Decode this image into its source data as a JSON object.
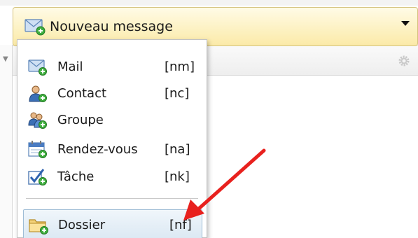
{
  "toolbar": {
    "new_button_label": "Nouveau message",
    "new_button_icon": "mail-new-icon",
    "dropdown_icon": "dropdown-arrow-icon"
  },
  "pane": {
    "collapse_icon": "collapse-triangle-icon",
    "settings_icon": "gear-icon"
  },
  "menu": {
    "items": [
      {
        "label": "Mail",
        "shortcut": "[nm]",
        "icon": "mail-new-icon"
      },
      {
        "label": "Contact",
        "shortcut": "[nc]",
        "icon": "contact-new-icon"
      },
      {
        "label": "Groupe",
        "shortcut": "",
        "icon": "group-new-icon"
      },
      {
        "label": "Rendez-vous",
        "shortcut": "[na]",
        "icon": "calendar-new-icon"
      },
      {
        "label": "Tâche",
        "shortcut": "[nk]",
        "icon": "task-new-icon"
      }
    ],
    "folder_item": {
      "label": "Dossier",
      "shortcut": "[nf]",
      "icon": "folder-new-icon"
    }
  },
  "annotation": {
    "type": "arrow",
    "color": "#e8211e",
    "points_to": "Dossier"
  },
  "colors": {
    "button_gradient_top": "#fffbe6",
    "button_gradient_bottom": "#fbeaa8",
    "selection_border": "#9fbdd6",
    "selection_fill": "#dbe8f3",
    "arrow": "#e8211e"
  }
}
